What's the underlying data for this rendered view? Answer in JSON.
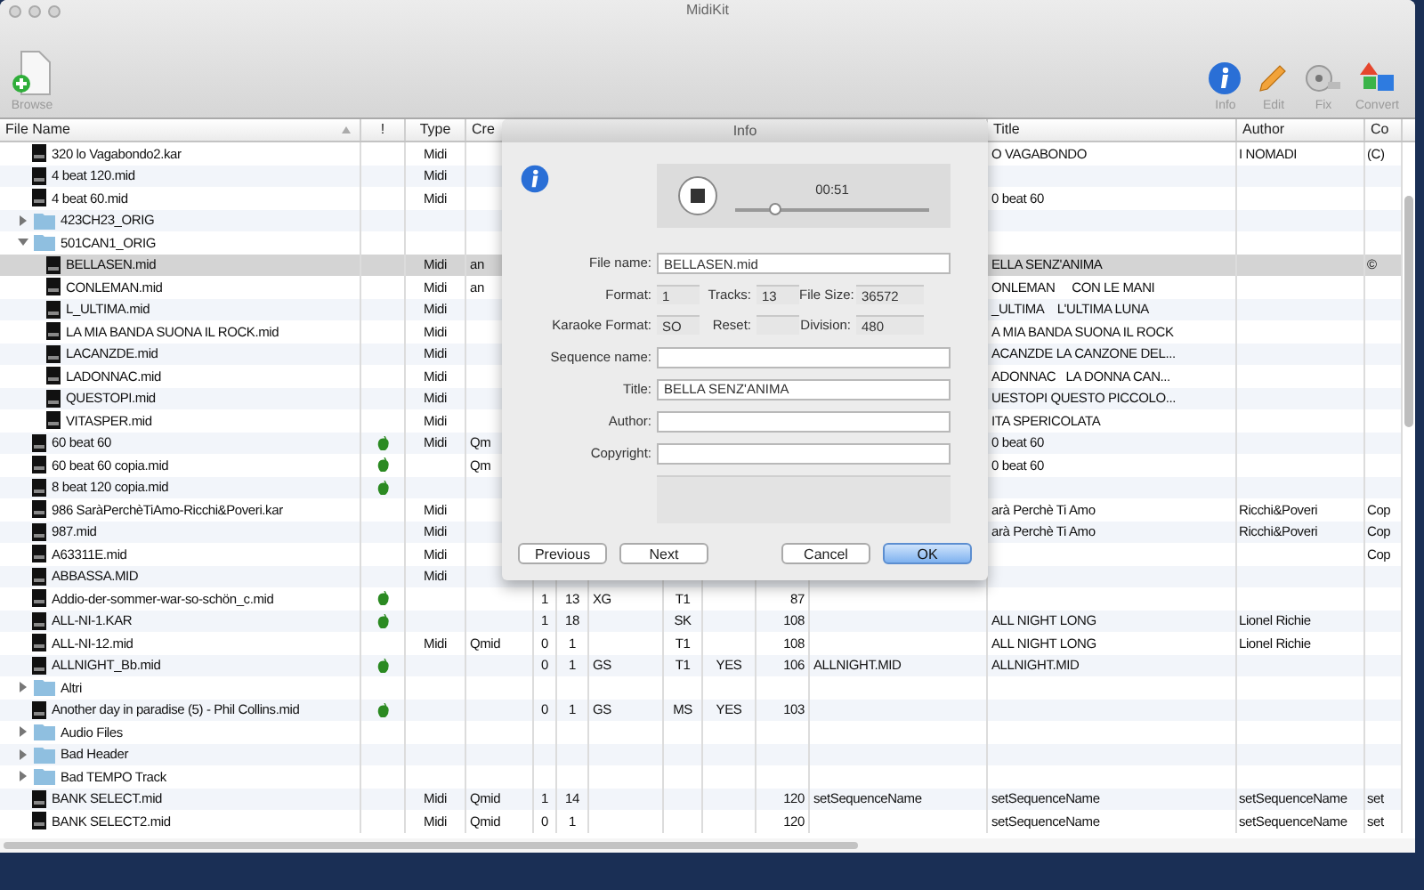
{
  "window": {
    "title": "MidiKit"
  },
  "toolbar": {
    "left": [
      {
        "kind": "browse",
        "label": "Browse"
      }
    ],
    "right": [
      {
        "kind": "info",
        "label": "Info"
      },
      {
        "kind": "edit",
        "label": "Edit"
      },
      {
        "kind": "fix",
        "label": "Fix"
      },
      {
        "kind": "convert",
        "label": "Convert"
      }
    ]
  },
  "table": {
    "columns": [
      "File Name",
      "!",
      "Type",
      "Cre",
      null,
      null,
      null,
      null,
      null,
      null,
      null,
      "Title",
      "Author",
      "Co"
    ],
    "rows": [
      {
        "kind": "file",
        "name": "320 lo Vagabondo2.kar",
        "flagged": false,
        "selected": false,
        "cells": [
          "Midi",
          null,
          null,
          null,
          null,
          null,
          null,
          null,
          null,
          "O VAGABONDO",
          "I NOMADI",
          "(C)"
        ]
      },
      {
        "kind": "file",
        "name": "4 beat 120.mid",
        "flagged": false,
        "selected": false,
        "cells": [
          "Midi",
          null,
          null,
          null,
          null,
          null,
          null,
          null,
          null,
          null,
          null,
          null
        ]
      },
      {
        "kind": "file",
        "name": "4 beat 60.mid",
        "flagged": false,
        "selected": false,
        "cells": [
          "Midi",
          null,
          null,
          null,
          null,
          null,
          null,
          null,
          null,
          "0 beat 60",
          null,
          null
        ]
      },
      {
        "kind": "folder",
        "name": "423CH23_ORIG",
        "expanded": false,
        "selected": false
      },
      {
        "kind": "folder",
        "name": "501CAN1_ORIG",
        "expanded": true,
        "selected": false,
        "children": [
          {
            "kind": "file",
            "name": "BELLASEN.mid",
            "flagged": false,
            "selected": true,
            "cells": [
              "Midi",
              "an",
              null,
              null,
              null,
              null,
              null,
              null,
              null,
              "ELLA SENZ'ANIMA",
              null,
              "©"
            ]
          },
          {
            "kind": "file",
            "name": "CONLEMAN.mid",
            "flagged": false,
            "selected": false,
            "cells": [
              "Midi",
              "an",
              null,
              null,
              null,
              null,
              null,
              null,
              null,
              "ONLEMAN     CON LE MANI",
              null,
              null
            ]
          },
          {
            "kind": "file",
            "name": "L_ULTIMA.mid",
            "flagged": false,
            "selected": false,
            "cells": [
              "Midi",
              null,
              null,
              null,
              null,
              null,
              null,
              null,
              null,
              "_ULTIMA    L'ULTIMA LUNA",
              null,
              null
            ]
          },
          {
            "kind": "file",
            "name": "LA MIA BANDA SUONA IL ROCK.mid",
            "flagged": false,
            "selected": false,
            "cells": [
              "Midi",
              null,
              null,
              null,
              null,
              null,
              null,
              null,
              null,
              "A MIA BANDA SUONA IL ROCK",
              null,
              null
            ]
          },
          {
            "kind": "file",
            "name": "LACANZDE.mid",
            "flagged": false,
            "selected": false,
            "cells": [
              "Midi",
              null,
              null,
              null,
              null,
              null,
              null,
              null,
              null,
              "ACANZDE LA CANZONE DEL...",
              null,
              null
            ]
          },
          {
            "kind": "file",
            "name": "LADONNAC.mid",
            "flagged": false,
            "selected": false,
            "cells": [
              "Midi",
              null,
              null,
              null,
              null,
              null,
              null,
              null,
              null,
              "ADONNAC   LA DONNA CAN...",
              null,
              null
            ]
          },
          {
            "kind": "file",
            "name": "QUESTOPI.mid",
            "flagged": false,
            "selected": false,
            "cells": [
              "Midi",
              null,
              null,
              null,
              null,
              null,
              null,
              null,
              null,
              "UESTOPI QUESTO PICCOLO...",
              null,
              null
            ]
          },
          {
            "kind": "file",
            "name": "VITASPER.mid",
            "flagged": false,
            "selected": false,
            "cells": [
              "Midi",
              null,
              null,
              null,
              null,
              null,
              null,
              null,
              null,
              "ITA SPERICOLATA",
              null,
              null
            ]
          }
        ]
      },
      {
        "kind": "file",
        "name": "60 beat 60",
        "flagged": true,
        "selected": false,
        "cells": [
          "Midi",
          "Qm",
          null,
          null,
          null,
          null,
          null,
          null,
          null,
          "0 beat 60",
          null,
          null
        ]
      },
      {
        "kind": "file",
        "name": "60 beat 60 copia.mid",
        "flagged": true,
        "selected": false,
        "cells": [
          null,
          "Qm",
          null,
          null,
          null,
          null,
          null,
          null,
          null,
          "0 beat 60",
          null,
          null
        ]
      },
      {
        "kind": "file",
        "name": "8 beat 120 copia.mid",
        "flagged": true,
        "selected": false,
        "cells": [
          null,
          null,
          null,
          null,
          null,
          null,
          null,
          null,
          null,
          null,
          null,
          null
        ]
      },
      {
        "kind": "file",
        "name": "986 SaràPerchèTiAmo-Ricchi&Poveri.kar",
        "flagged": false,
        "selected": false,
        "cells": [
          "Midi",
          null,
          null,
          null,
          null,
          null,
          null,
          null,
          null,
          "arà Perchè Ti Amo",
          "Ricchi&Poveri",
          "Cop"
        ]
      },
      {
        "kind": "file",
        "name": "987.mid",
        "flagged": false,
        "selected": false,
        "cells": [
          "Midi",
          null,
          null,
          null,
          null,
          null,
          null,
          null,
          null,
          "arà Perchè Ti Amo",
          "Ricchi&Poveri",
          "Cop"
        ]
      },
      {
        "kind": "file",
        "name": "A63311E.mid",
        "flagged": false,
        "selected": false,
        "cells": [
          "Midi",
          null,
          null,
          null,
          null,
          null,
          null,
          null,
          null,
          null,
          null,
          "Cop"
        ]
      },
      {
        "kind": "file",
        "name": "ABBASSA.MID",
        "flagged": false,
        "selected": false,
        "cells": [
          "Midi",
          null,
          null,
          null,
          null,
          null,
          null,
          null,
          null,
          null,
          null,
          null
        ]
      },
      {
        "kind": "file",
        "name": "Addio-der-sommer-war-so-schön_c.mid",
        "flagged": true,
        "selected": false,
        "cells": [
          null,
          null,
          "1",
          "13",
          "XG",
          "T1",
          null,
          "87",
          null,
          null,
          null,
          null
        ]
      },
      {
        "kind": "file",
        "name": "ALL-NI-1.KAR",
        "flagged": true,
        "selected": false,
        "cells": [
          null,
          null,
          "1",
          "18",
          null,
          "SK",
          null,
          "108",
          null,
          "ALL NIGHT LONG",
          "Lionel Richie",
          null
        ]
      },
      {
        "kind": "file",
        "name": "ALL-NI-12.mid",
        "flagged": false,
        "selected": false,
        "cells": [
          "Midi",
          "Qmid",
          "0",
          "1",
          null,
          "T1",
          null,
          "108",
          null,
          "ALL NIGHT LONG",
          "Lionel Richie",
          null
        ]
      },
      {
        "kind": "file",
        "name": "ALLNIGHT_Bb.mid",
        "flagged": true,
        "selected": false,
        "cells": [
          null,
          null,
          "0",
          "1",
          "GS",
          "T1",
          "YES",
          "106",
          "ALLNIGHT.MID",
          "ALLNIGHT.MID",
          null,
          null
        ]
      },
      {
        "kind": "folder",
        "name": "Altri",
        "expanded": false,
        "selected": false
      },
      {
        "kind": "file",
        "name": "Another day in paradise (5) - Phil Collins.mid",
        "flagged": true,
        "selected": false,
        "cells": [
          null,
          null,
          "0",
          "1",
          "GS",
          "MS",
          "YES",
          "103",
          null,
          null,
          null,
          null
        ]
      },
      {
        "kind": "folder",
        "name": "Audio Files",
        "expanded": false,
        "selected": false
      },
      {
        "kind": "folder",
        "name": "Bad Header",
        "expanded": false,
        "selected": false
      },
      {
        "kind": "folder",
        "name": "Bad TEMPO Track",
        "expanded": false,
        "selected": false
      },
      {
        "kind": "file",
        "name": "BANK SELECT.mid",
        "flagged": false,
        "selected": false,
        "cells": [
          "Midi",
          "Qmid",
          "1",
          "14",
          null,
          null,
          null,
          "120",
          "setSequenceName",
          "setSequenceName",
          "setSequenceName",
          "set"
        ]
      },
      {
        "kind": "file",
        "name": "BANK SELECT2.mid",
        "flagged": false,
        "selected": false,
        "cells": [
          "Midi",
          "Qmid",
          "0",
          "1",
          null,
          null,
          null,
          "120",
          null,
          "setSequenceName",
          "setSequenceName",
          "set"
        ]
      }
    ]
  },
  "info_dialog": {
    "title": "Info",
    "player": {
      "time": "00:51",
      "level": 0.2
    },
    "file_name": {
      "label": "File name:",
      "value": "BELLASEN.mid"
    },
    "stats": [
      [
        {
          "label": "Format:",
          "value": "1"
        },
        {
          "label": "Tracks:",
          "value": "13"
        },
        {
          "label": "File Size:",
          "value": "36572"
        }
      ],
      [
        {
          "label": "Karaoke Format:",
          "value": "SO"
        },
        {
          "label": "Reset:"
        },
        {
          "label": "Division:",
          "value": "480"
        }
      ]
    ],
    "fields": [
      {
        "label": "Sequence name:"
      },
      {
        "label": "Title:",
        "value": "BELLA SENZ'ANIMA"
      },
      {
        "label": "Author:"
      },
      {
        "label": "Copyright:"
      }
    ],
    "buttons": [
      {
        "label": "Previous",
        "default": false
      },
      {
        "label": "Next",
        "default": false
      },
      {
        "label": "Cancel",
        "default": false
      },
      {
        "label": "OK",
        "default": true
      }
    ]
  }
}
